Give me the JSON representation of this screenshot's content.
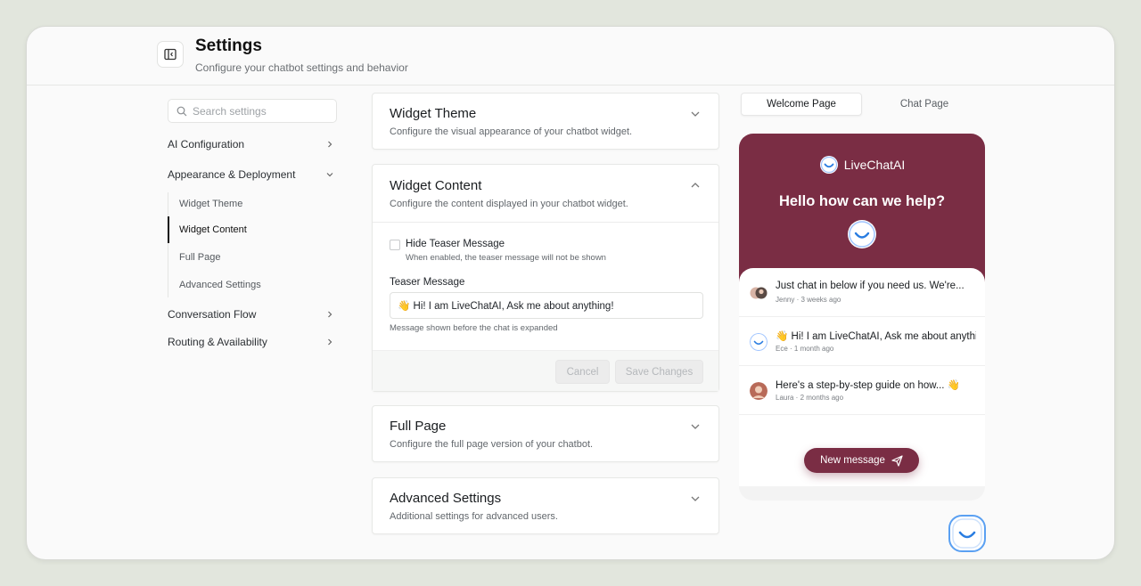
{
  "header": {
    "title": "Settings",
    "subtitle": "Configure your chatbot settings and behavior"
  },
  "sidebar": {
    "search_placeholder": "Search settings",
    "items": [
      {
        "label": "AI Configuration"
      },
      {
        "label": "Appearance & Deployment"
      },
      {
        "label": "Conversation Flow"
      },
      {
        "label": "Routing & Availability"
      }
    ],
    "subitems": [
      {
        "label": "Widget Theme"
      },
      {
        "label": "Widget Content"
      },
      {
        "label": "Full Page"
      },
      {
        "label": "Advanced Settings"
      }
    ],
    "active_subitem": "Widget Content"
  },
  "cards": {
    "widget_theme": {
      "title": "Widget Theme",
      "desc": "Configure the visual appearance of your chatbot widget."
    },
    "widget_content": {
      "title": "Widget Content",
      "desc": "Configure the content displayed in your chatbot widget.",
      "checkbox_label": "Hide Teaser Message",
      "checkbox_help": "When enabled, the teaser message will not be shown",
      "checkbox_checked": false,
      "field_label": "Teaser Message",
      "field_value": "👋 Hi! I am LiveChatAI, Ask me about anything!",
      "field_help": "Message shown before the chat is expanded",
      "cancel_label": "Cancel",
      "save_label": "Save Changes"
    },
    "full_page": {
      "title": "Full Page",
      "desc": "Configure the full page version of your chatbot."
    },
    "advanced": {
      "title": "Advanced Settings",
      "desc": "Additional settings for advanced users."
    }
  },
  "preview": {
    "tabs": [
      {
        "label": "Welcome Page"
      },
      {
        "label": "Chat Page"
      }
    ],
    "active_tab": "Welcome Page",
    "brand": "LiveChatAI",
    "hero_title": "Hello how can we help?",
    "conversations": [
      {
        "text": "Just chat in below if you need us. We're...",
        "meta": "Jenny · 3 weeks ago"
      },
      {
        "text": "👋 Hi! I am LiveChatAI, Ask me about anythi",
        "meta": "Ece · 1 month ago"
      },
      {
        "text": "Here's a step-by-step guide on how... 👋",
        "meta": "Laura · 2 months ago"
      }
    ],
    "new_message_label": "New message",
    "brand_color": "#7a2d44"
  },
  "icons": [
    "sidebar-toggle-icon",
    "search-icon",
    "chevron-right-icon",
    "chevron-down-icon",
    "chevron-up-icon",
    "smiley-logo-icon",
    "send-icon"
  ]
}
